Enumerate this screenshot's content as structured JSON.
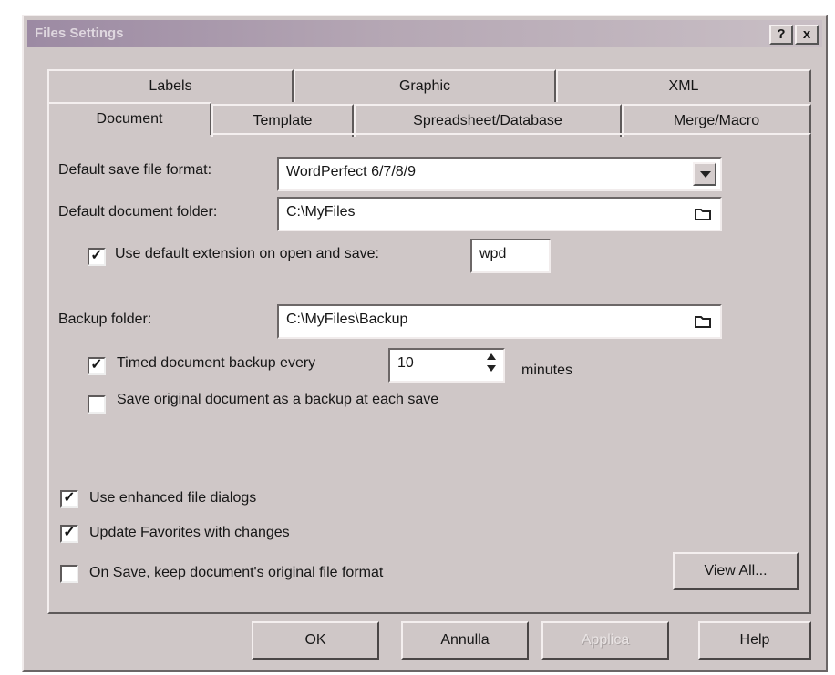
{
  "window": {
    "title": "Files Settings",
    "help_glyph": "?",
    "close_glyph": "x"
  },
  "tabs": {
    "row1": [
      "Labels",
      "Graphic",
      "XML"
    ],
    "row2": [
      "Document",
      "Template",
      "Spreadsheet/Database",
      "Merge/Macro"
    ],
    "active": "Document"
  },
  "document": {
    "save_format_label": "Default save file format:",
    "save_format_value": "WordPerfect 6/7/8/9",
    "doc_folder_label": "Default document folder:",
    "doc_folder_value": "C:\\MyFiles",
    "default_ext_label": "Use default extension on open and save:",
    "default_ext_checked": true,
    "default_ext_value": "wpd",
    "backup_folder_label": "Backup folder:",
    "backup_folder_value": "C:\\MyFiles\\Backup",
    "timed_backup_label": "Timed document backup every",
    "timed_backup_checked": true,
    "timed_backup_value": "10",
    "minutes_label": "minutes",
    "save_original_label": "Save original document as a backup at each save",
    "save_original_checked": false,
    "enhanced_dialogs_label": "Use enhanced file dialogs",
    "enhanced_dialogs_checked": true,
    "update_favorites_label": "Update Favorites with changes",
    "update_favorites_checked": true,
    "keep_format_label": "On Save, keep document's original file format",
    "keep_format_checked": false,
    "view_all_label": "View All..."
  },
  "buttons": {
    "ok": "OK",
    "cancel": "Annulla",
    "apply": "Applica",
    "help": "Help"
  },
  "icons": {
    "folder": "folder-browse-icon",
    "dropdown": "chevron-down-icon",
    "spinner": "spin-up-down-icon"
  }
}
